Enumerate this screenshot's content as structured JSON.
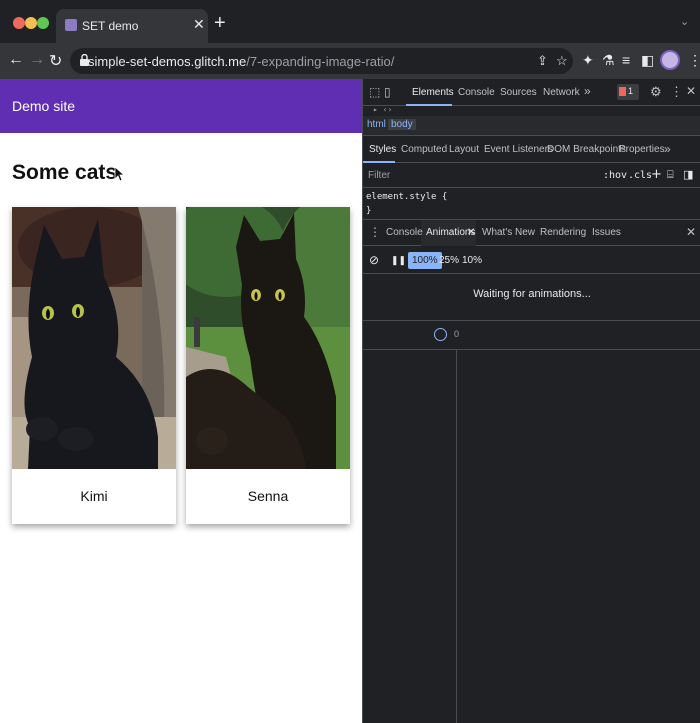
{
  "browser": {
    "tab_title": "SET demo",
    "url_host": "simple-set-demos.glitch.me",
    "url_path": "/7-expanding-image-ratio/"
  },
  "page": {
    "site_title": "Demo site",
    "heading": "Some cats",
    "cards": [
      {
        "name": "Kimi"
      },
      {
        "name": "Senna"
      }
    ]
  },
  "devtools": {
    "tabs": [
      "Elements",
      "Console",
      "Sources",
      "Network"
    ],
    "issues_count": "1",
    "breadcrumbs": [
      "html",
      "body"
    ],
    "styles_tabs": [
      "Styles",
      "Computed",
      "Layout",
      "Event Listeners",
      "DOM Breakpoints",
      "Properties"
    ],
    "filter_placeholder": "Filter",
    "hov": ":hov",
    "cls": ".cls",
    "element_style": "element.style {",
    "close_brace": "}",
    "drawer_tabs": [
      "Console",
      "Animations",
      "What's New",
      "Rendering",
      "Issues"
    ],
    "speeds": [
      "100%",
      "25%",
      "10%"
    ],
    "waiting_text": "Waiting for animations...",
    "timeline_zero": "0"
  }
}
